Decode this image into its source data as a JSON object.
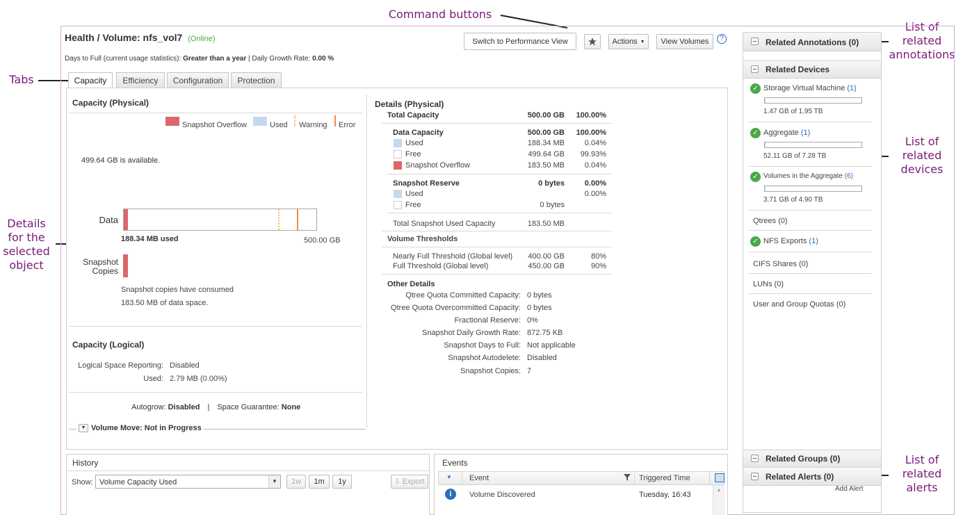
{
  "callouts": {
    "command_buttons": "Command buttons",
    "tabs": "Tabs",
    "details_lines": [
      "Details",
      "for the",
      "selected",
      "object"
    ],
    "annotations_lines": [
      "List of",
      "related",
      "annotations"
    ],
    "devices_lines": [
      "List of",
      "related",
      "devices"
    ],
    "alerts_lines": [
      "List of",
      "related",
      "alerts"
    ]
  },
  "header": {
    "title": "Health / Volume: nfs_vol7",
    "status": "(Online)",
    "summary_label": "Days to Full (current usage statistics): ",
    "summary_value": "Greater than a year",
    "growth_label": " | Daily Growth Rate: ",
    "growth_value": "0.00 %"
  },
  "toolbar": {
    "switch_label": "Switch to Performance View",
    "actions_label": "Actions",
    "view_volumes_label": "View Volumes",
    "help": "?"
  },
  "tabs": [
    {
      "label": "Capacity",
      "active": true
    },
    {
      "label": "Efficiency",
      "active": false
    },
    {
      "label": "Configuration",
      "active": false
    },
    {
      "label": "Protection",
      "active": false
    }
  ],
  "capacity_physical": {
    "title": "Capacity (Physical)",
    "legend": [
      "Snapshot Overflow",
      "Used",
      "Warning",
      "Error"
    ],
    "available": "499.64 GB is available.",
    "data_label": "Data",
    "used_text": "188.34 MB used",
    "total_text": "500.00 GB",
    "snapshot_label_1": "Snapshot",
    "snapshot_label_2": "Copies",
    "snapshot_note_1": "Snapshot copies have consumed",
    "snapshot_note_2": "183.50 MB of data space.",
    "warning_fraction": 0.8,
    "error_fraction": 0.9
  },
  "capacity_logical": {
    "title": "Capacity (Logical)",
    "reporting_label": "Logical Space Reporting:",
    "reporting_value": "Disabled",
    "used_label": "Used:",
    "used_value": "2.79 MB (0.00%)",
    "autogrow_label": "Autogrow: ",
    "autogrow_value": "Disabled",
    "divider": "|",
    "guarantee_label": "Space Guarantee: ",
    "guarantee_value": "None",
    "volume_move": "Volume Move: Not in Progress"
  },
  "details": {
    "title": "Details (Physical)",
    "total_label": "Total Capacity",
    "total_value": "500.00 GB",
    "total_pct": "100.00%",
    "data_label": "Data Capacity",
    "data_value": "500.00 GB",
    "data_pct": "100.00%",
    "used_label": "Used",
    "used_value": "188.34 MB",
    "used_pct": "0.04%",
    "free_label": "Free",
    "free_value": "499.64 GB",
    "free_pct": "99.93%",
    "overflow_label": "Snapshot Overflow",
    "overflow_value": "183.50 MB",
    "overflow_pct": "0.04%",
    "reserve_label": "Snapshot Reserve",
    "reserve_value": "0 bytes",
    "reserve_pct": "0.00%",
    "reserve_used_label": "Used",
    "reserve_used_pct": "0.00%",
    "reserve_free_label": "Free",
    "reserve_free_value": "0 bytes",
    "snap_used_label": "Total Snapshot Used Capacity",
    "snap_used_value": "183.50 MB",
    "thresholds_title": "Volume Thresholds",
    "nearly_label": "Nearly Full Threshold (Global level)",
    "nearly_value": "400.00 GB",
    "nearly_pct": "80%",
    "full_label": "Full Threshold (Global level)",
    "full_value": "450.00 GB",
    "full_pct": "90%",
    "other_title": "Other Details",
    "other": [
      {
        "label": "Qtree Quota Committed Capacity:",
        "value": "0 bytes"
      },
      {
        "label": "Qtree Quota Overcommitted Capacity:",
        "value": "0 bytes"
      },
      {
        "label": "Fractional Reserve:",
        "value": "0%"
      },
      {
        "label": "Snapshot Daily Growth Rate:",
        "value": "872.75 KB"
      },
      {
        "label": "Snapshot Days to Full:",
        "value": "Not applicable"
      },
      {
        "label": "Snapshot Autodelete:",
        "value": "Disabled"
      },
      {
        "label": "Snapshot Copies:",
        "value": "7"
      }
    ]
  },
  "history": {
    "title": "History",
    "show_label": "Show:",
    "select_value": "Volume Capacity Used",
    "ranges": [
      "1w",
      "1m",
      "1y"
    ],
    "export_label": "Export"
  },
  "events": {
    "title": "Events",
    "col_event": "Event",
    "col_time": "Triggered Time",
    "rows": [
      {
        "event": "Volume Discovered",
        "time": "Tuesday, 16:43"
      }
    ]
  },
  "sidebar": {
    "annotations": "Related Annotations (0)",
    "devices": "Related Devices",
    "items": [
      {
        "label": "Storage Virtual Machine",
        "count": "(1)",
        "bar_text": "1.47 GB of 1.95 TB",
        "fill": 0.001
      },
      {
        "label": "Aggregate",
        "count": "(1)",
        "bar_text": "52.11 GB of 7.28 TB",
        "fill": 0.007
      },
      {
        "label": "Volumes in the Aggregate",
        "count": "(6)",
        "bar_text": "3.71 GB of 4.90 TB",
        "fill": 0.001
      }
    ],
    "qtrees": "Qtrees (0)",
    "nfs_label": "NFS Exports",
    "nfs_count": "(1)",
    "cifs": "CIFS Shares (0)",
    "luns": "LUNs (0)",
    "quotas": "User and Group Quotas (0)",
    "groups": "Related Groups (0)",
    "alerts": "Related Alerts (0)",
    "add_alert": "Add Alert"
  },
  "colors": {
    "overflow": "#d9686a",
    "used": "#c5d9ee",
    "warning": "#f0c24a",
    "error": "#f08a4a",
    "ok": "#4aa84a",
    "link": "#2a6ebb",
    "callout": "#7a1a7a"
  }
}
